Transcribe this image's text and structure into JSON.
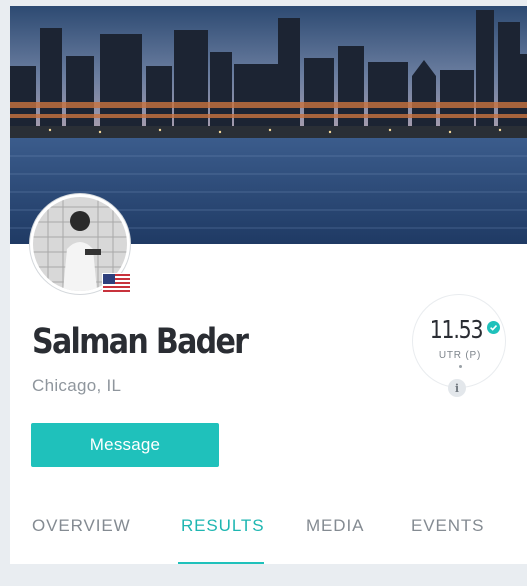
{
  "profile": {
    "name": "Salman Bader",
    "location": "Chicago, IL",
    "country_flag_icon": "us-flag-icon"
  },
  "rating": {
    "value": "11.53",
    "label": "UTR (P)",
    "verified_icon": "verified-check-icon",
    "info_label": "i"
  },
  "actions": {
    "message_label": "Message"
  },
  "tabs": [
    {
      "label": "OVERVIEW",
      "active": false
    },
    {
      "label": "RESULTS",
      "active": true
    },
    {
      "label": "MEDIA",
      "active": false
    },
    {
      "label": "EVENTS",
      "active": false
    }
  ],
  "colors": {
    "accent": "#1fc1bb",
    "name_text": "#2a2d33",
    "muted_text": "#8f969d"
  }
}
